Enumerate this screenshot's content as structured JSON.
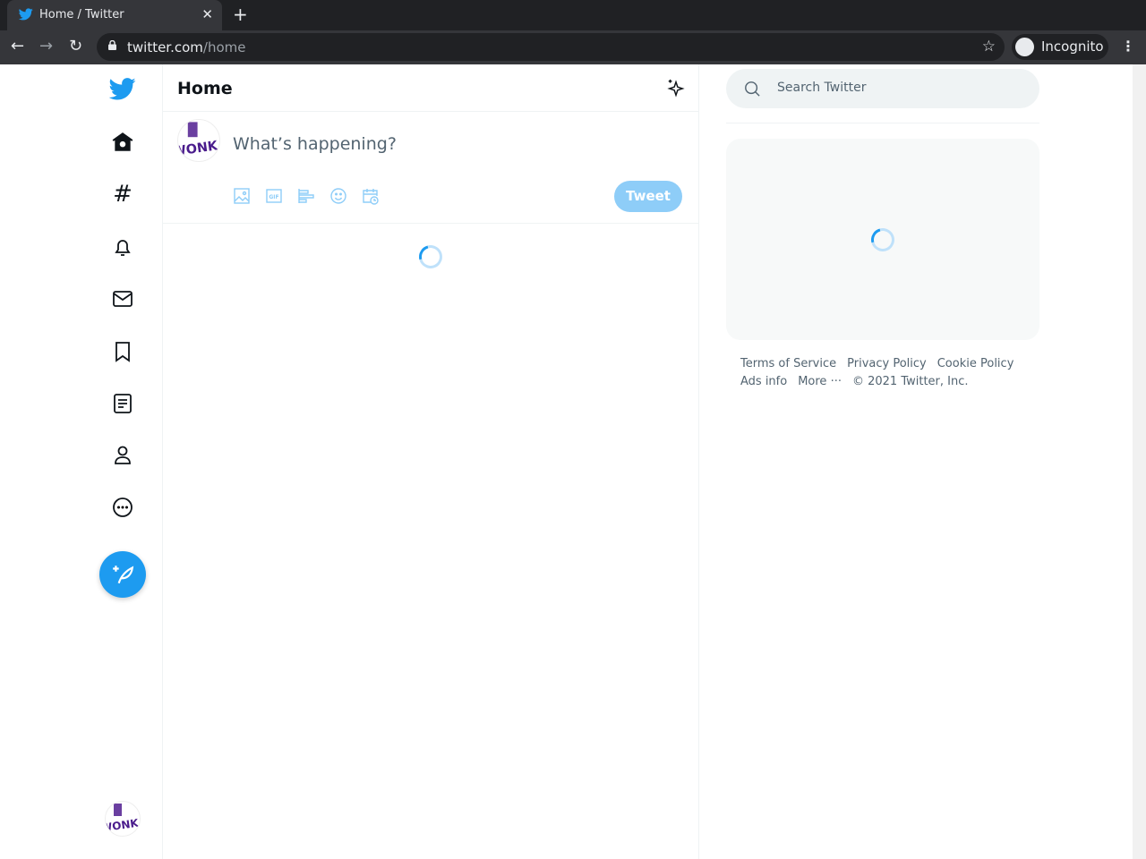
{
  "browser": {
    "tab_title": "Home / Twitter",
    "url_host": "twitter.com",
    "url_path": "/home",
    "profile_label": "Incognito"
  },
  "header": {
    "title": "Home"
  },
  "composer": {
    "placeholder": "What’s happening?",
    "tweet_label": "Tweet"
  },
  "search": {
    "placeholder": "Search Twitter"
  },
  "footer": {
    "links": [
      "Terms of Service",
      "Privacy Policy",
      "Cookie Policy",
      "Ads info",
      "More ···"
    ],
    "copyright": "© 2021 Twitter, Inc."
  },
  "avatar": {
    "logo_text": "WONKA"
  },
  "colors": {
    "accent": "#1d9bf0",
    "tweet_disabled": "#8ecdf8"
  }
}
